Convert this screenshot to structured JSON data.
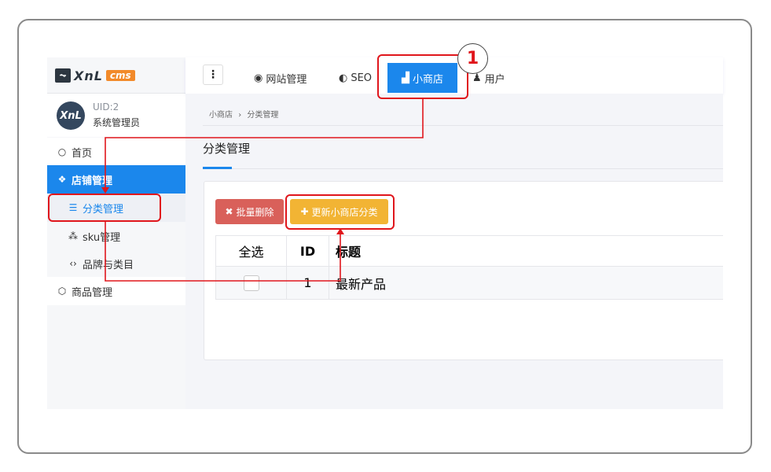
{
  "logo": {
    "text": "XnL",
    "badge": "cms"
  },
  "user": {
    "avatar_text": "XnL",
    "uid": "UID:2",
    "role": "系统管理员"
  },
  "sidebar": {
    "items": [
      {
        "label": "首页",
        "icon": "circle-icon"
      },
      {
        "label": "店铺管理",
        "icon": "cube-icon"
      },
      {
        "label": "分类管理",
        "icon": "list-icon"
      },
      {
        "label": "sku管理",
        "icon": "cubes-icon"
      },
      {
        "label": "品牌与类目",
        "icon": "code-icon"
      },
      {
        "label": "商品管理",
        "icon": "hexagon-icon"
      }
    ]
  },
  "topnav": {
    "menu_icon": "⋮",
    "items": [
      {
        "label": "网站管理",
        "icon": "chrome-icon"
      },
      {
        "label": "SEO",
        "icon": "compass-icon"
      },
      {
        "label": "小商店",
        "icon": "shopping-bag-icon"
      },
      {
        "label": "用户",
        "icon": "user-icon"
      }
    ]
  },
  "breadcrumb": {
    "parent": "小商店",
    "separator": "›",
    "current": "分类管理"
  },
  "page": {
    "title": "分类管理"
  },
  "toolbar": {
    "delete_label": "批量删除",
    "delete_icon": "✖",
    "add_label": "更新小商店分类",
    "add_icon": "✚"
  },
  "table": {
    "headers": [
      "全选",
      "ID",
      "标题"
    ],
    "rows": [
      {
        "id": "1",
        "title": "最新产品"
      }
    ]
  },
  "annotation": {
    "step": "1"
  },
  "colors": {
    "primary": "#1b87ec",
    "danger": "#d9605a",
    "warning": "#f2b434",
    "annotation": "#e0161c"
  }
}
